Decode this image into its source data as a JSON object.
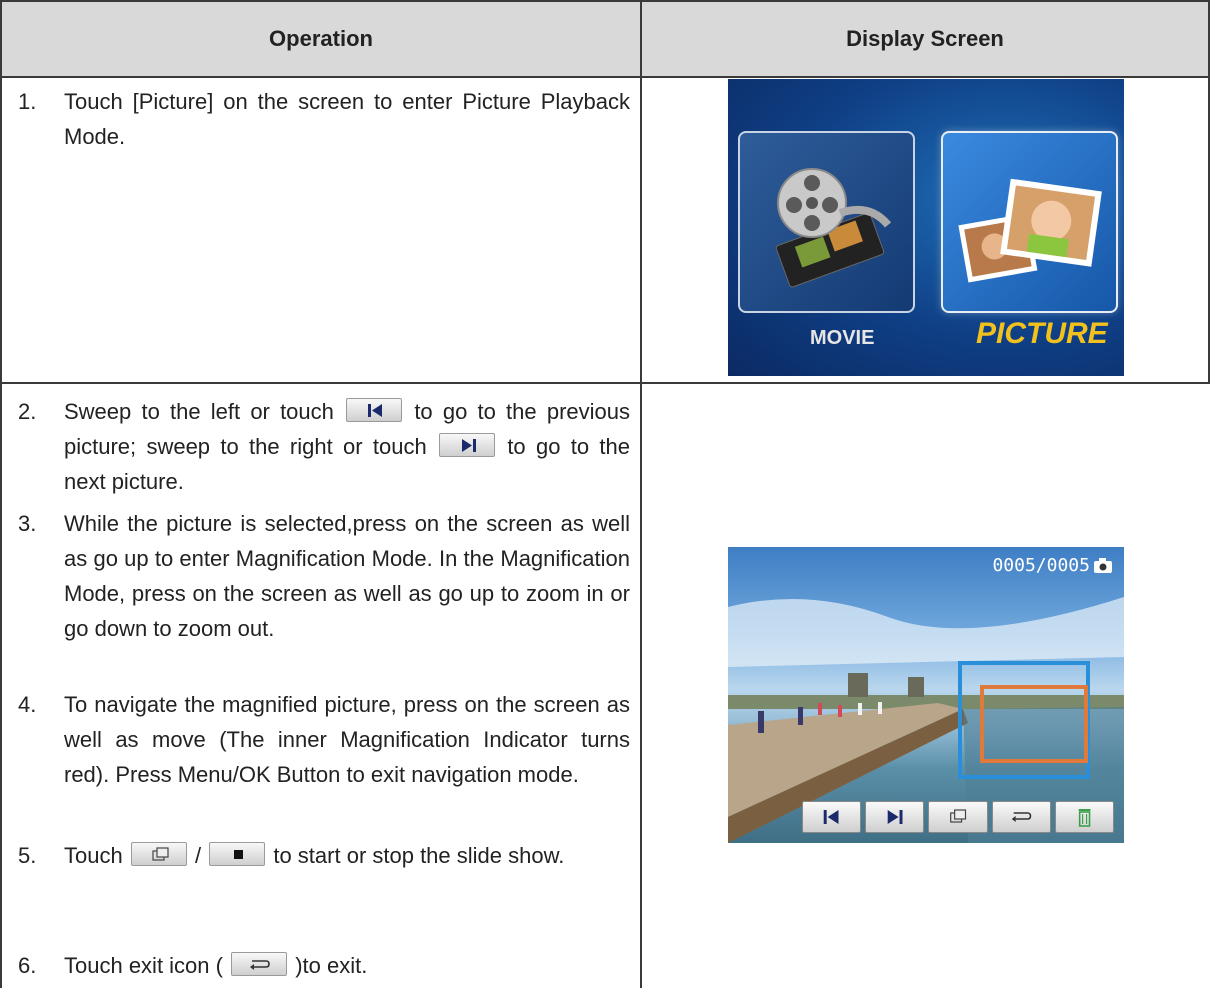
{
  "table": {
    "headers": {
      "operation": "Operation",
      "display": "Display Screen"
    }
  },
  "steps": [
    {
      "num": "1.",
      "text": "Touch [Picture] on the screen to enter Picture Playback Mode."
    },
    {
      "num": "2.",
      "text_a": "Sweep to the left or touch",
      "text_b": "to go to the previous picture; sweep to the right or touch",
      "text_c": "to go to the next picture."
    },
    {
      "num": "3.",
      "text": "While the picture is selected,press on the screen as well as go up to enter Magnification Mode. In the Magnification Mode, press on the screen as well as go up to zoom in or go down to zoom out."
    },
    {
      "num": "4.",
      "text": "To navigate the magnified picture, press on the screen as well as move (The inner Magnification Indicator turns red). Press Menu/OK Button to exit navigation mode."
    },
    {
      "num": "5.",
      "text_a": "Touch",
      "text_sep": "/",
      "text_b": "to start or stop the slide show."
    },
    {
      "num": "6.",
      "text_a": "Touch exit icon (",
      "text_b": ")to exit."
    }
  ],
  "screen1": {
    "movie_label": "MOVIE",
    "picture_label": "PICTURE"
  },
  "screen2": {
    "counter": "0005/0005"
  },
  "icons": {
    "previous": "previous-icon",
    "next": "next-icon",
    "slideshow": "slideshow-icon",
    "stop": "stop-icon",
    "exit": "exit-icon",
    "delete": "trash-icon",
    "camera": "camera-icon"
  },
  "colors": {
    "header_bg": "#d9d9d9",
    "border": "#3a3a3a",
    "picture_label": "#f2c11e",
    "magnify_outer": "#2a8fd8",
    "magnify_inner": "#e07a3a"
  }
}
